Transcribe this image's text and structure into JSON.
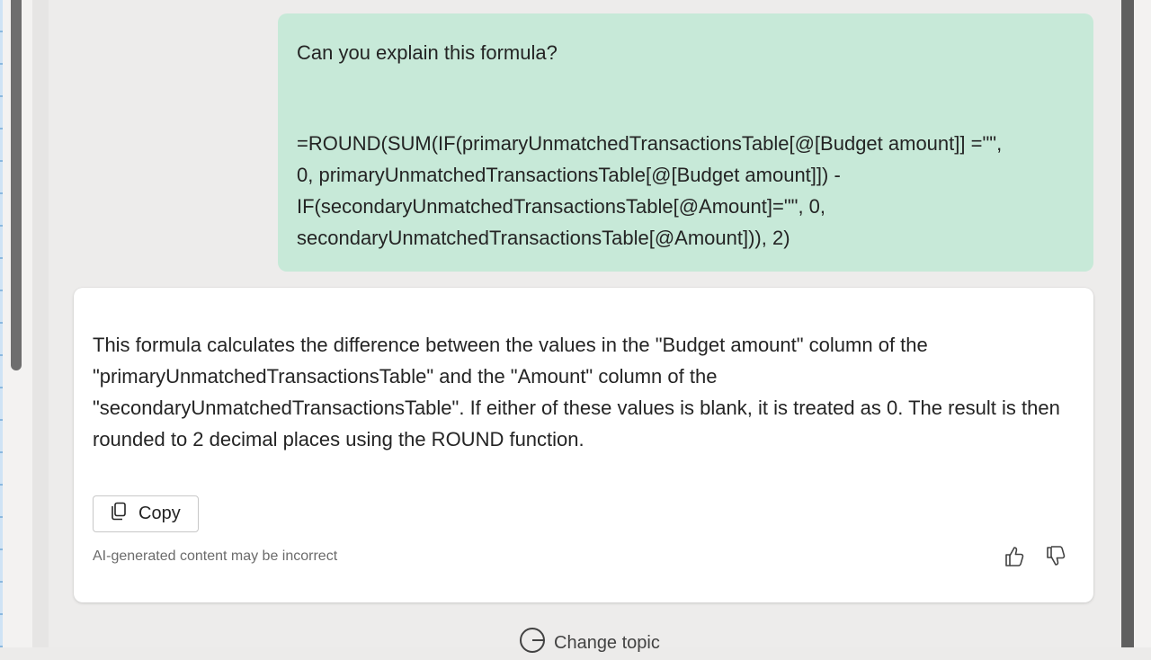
{
  "user_message": {
    "question": "Can you explain this formula?",
    "formula": "=ROUND(SUM(IF(primaryUnmatchedTransactionsTable[@[Budget amount]] =\"\",\n0, primaryUnmatchedTransactionsTable[@[Budget amount]]) -\nIF(secondaryUnmatchedTransactionsTable[@Amount]=\"\", 0,\nsecondaryUnmatchedTransactionsTable[@Amount])), 2)"
  },
  "ai_response": {
    "text": "This formula calculates the difference between the values in the \"Budget amount\" column of the \"primaryUnmatchedTransactionsTable\" and the \"Amount\" column of the \"secondaryUnmatchedTransactionsTable\". If either of these values is blank, it is treated as 0. The result is then rounded to 2 decimal places using the ROUND function.",
    "copy_label": "Copy",
    "disclaimer": "AI-generated content may be incorrect",
    "icons": {
      "copy": "copy-icon",
      "like": "thumbs-up-icon",
      "dislike": "thumbs-down-icon"
    }
  },
  "footer": {
    "change_topic_label": "Change topic",
    "icon": "new-topic-icon"
  },
  "colors": {
    "user_bubble": "#c7e9d8",
    "card": "#ffffff",
    "background": "#edeceb"
  }
}
